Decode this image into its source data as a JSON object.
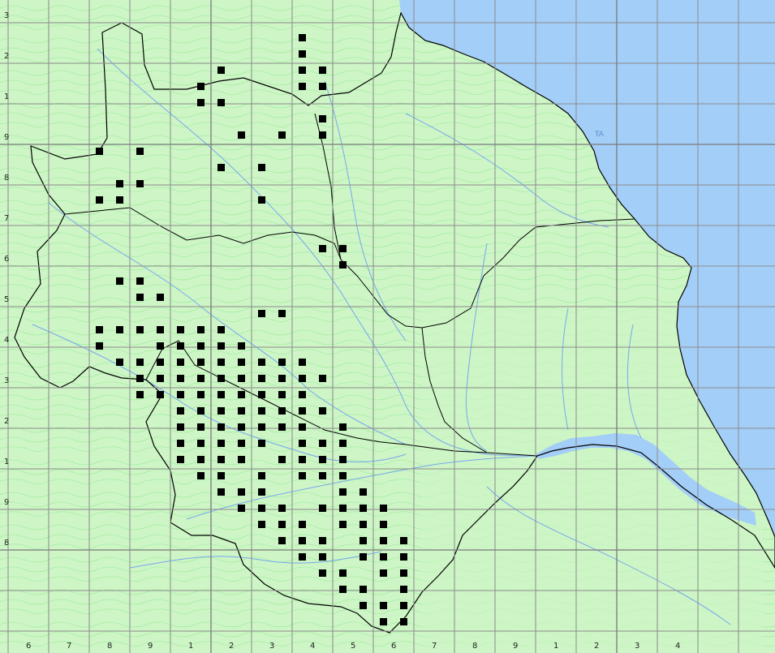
{
  "map": {
    "colors": {
      "land": "#cdf5c5",
      "sea": "#a3cef7",
      "contour": "#66e36f",
      "river": "#7aa7f0",
      "boundary": "#000000",
      "grid": "#8c8c8c",
      "record": "#000000"
    },
    "sea_label": "TA",
    "bottom_labels": [
      "6",
      "7",
      "8",
      "9",
      "1",
      "2",
      "3",
      "4",
      "5",
      "6",
      "7",
      "8",
      "9",
      "1",
      "2",
      "3",
      "4"
    ],
    "left_labels": [
      "3",
      "2",
      "1",
      "9",
      "8",
      "7",
      "6",
      "5",
      "4",
      "3",
      "2",
      "1",
      "9",
      "8"
    ],
    "records": [
      [
        14,
        1
      ],
      [
        14,
        2
      ],
      [
        14,
        3
      ],
      [
        15,
        3
      ],
      [
        10,
        3
      ],
      [
        9,
        4
      ],
      [
        14,
        4
      ],
      [
        15,
        4
      ],
      [
        9,
        5
      ],
      [
        10,
        5
      ],
      [
        15,
        6
      ],
      [
        11,
        7
      ],
      [
        13,
        7
      ],
      [
        15,
        7
      ],
      [
        4,
        8
      ],
      [
        6,
        8
      ],
      [
        10,
        9
      ],
      [
        12,
        9
      ],
      [
        5,
        10
      ],
      [
        6,
        10
      ],
      [
        4,
        11
      ],
      [
        5,
        11
      ],
      [
        12,
        11
      ],
      [
        15,
        14
      ],
      [
        16,
        14
      ],
      [
        16,
        15
      ],
      [
        5,
        16
      ],
      [
        6,
        16
      ],
      [
        6,
        17
      ],
      [
        7,
        17
      ],
      [
        12,
        18
      ],
      [
        13,
        18
      ],
      [
        4,
        19
      ],
      [
        5,
        19
      ],
      [
        6,
        19
      ],
      [
        7,
        19
      ],
      [
        8,
        19
      ],
      [
        9,
        19
      ],
      [
        10,
        19
      ],
      [
        4,
        20
      ],
      [
        7,
        20
      ],
      [
        8,
        20
      ],
      [
        9,
        20
      ],
      [
        10,
        20
      ],
      [
        11,
        20
      ],
      [
        5,
        21
      ],
      [
        6,
        21
      ],
      [
        7,
        21
      ],
      [
        8,
        21
      ],
      [
        9,
        21
      ],
      [
        10,
        21
      ],
      [
        11,
        21
      ],
      [
        12,
        21
      ],
      [
        13,
        21
      ],
      [
        14,
        21
      ],
      [
        6,
        22
      ],
      [
        7,
        22
      ],
      [
        8,
        22
      ],
      [
        9,
        22
      ],
      [
        10,
        22
      ],
      [
        11,
        22
      ],
      [
        12,
        22
      ],
      [
        13,
        22
      ],
      [
        14,
        22
      ],
      [
        15,
        22
      ],
      [
        6,
        23
      ],
      [
        7,
        23
      ],
      [
        8,
        23
      ],
      [
        9,
        23
      ],
      [
        10,
        23
      ],
      [
        11,
        23
      ],
      [
        12,
        23
      ],
      [
        13,
        23
      ],
      [
        14,
        23
      ],
      [
        8,
        24
      ],
      [
        9,
        24
      ],
      [
        10,
        24
      ],
      [
        11,
        24
      ],
      [
        12,
        24
      ],
      [
        13,
        24
      ],
      [
        14,
        24
      ],
      [
        15,
        24
      ],
      [
        8,
        25
      ],
      [
        9,
        25
      ],
      [
        10,
        25
      ],
      [
        11,
        25
      ],
      [
        12,
        25
      ],
      [
        13,
        25
      ],
      [
        14,
        25
      ],
      [
        16,
        25
      ],
      [
        8,
        26
      ],
      [
        9,
        26
      ],
      [
        10,
        26
      ],
      [
        11,
        26
      ],
      [
        12,
        26
      ],
      [
        14,
        26
      ],
      [
        15,
        26
      ],
      [
        16,
        26
      ],
      [
        8,
        27
      ],
      [
        9,
        27
      ],
      [
        10,
        27
      ],
      [
        11,
        27
      ],
      [
        13,
        27
      ],
      [
        14,
        27
      ],
      [
        15,
        27
      ],
      [
        16,
        27
      ],
      [
        9,
        28
      ],
      [
        10,
        28
      ],
      [
        12,
        28
      ],
      [
        14,
        28
      ],
      [
        15,
        28
      ],
      [
        16,
        28
      ],
      [
        10,
        29
      ],
      [
        11,
        29
      ],
      [
        12,
        29
      ],
      [
        16,
        29
      ],
      [
        17,
        29
      ],
      [
        11,
        30
      ],
      [
        12,
        30
      ],
      [
        13,
        30
      ],
      [
        15,
        30
      ],
      [
        16,
        30
      ],
      [
        17,
        30
      ],
      [
        18,
        30
      ],
      [
        12,
        31
      ],
      [
        13,
        31
      ],
      [
        14,
        31
      ],
      [
        16,
        31
      ],
      [
        17,
        31
      ],
      [
        18,
        31
      ],
      [
        13,
        32
      ],
      [
        14,
        32
      ],
      [
        15,
        32
      ],
      [
        17,
        32
      ],
      [
        18,
        32
      ],
      [
        19,
        32
      ],
      [
        14,
        33
      ],
      [
        15,
        33
      ],
      [
        17,
        33
      ],
      [
        18,
        33
      ],
      [
        19,
        33
      ],
      [
        15,
        34
      ],
      [
        16,
        34
      ],
      [
        18,
        34
      ],
      [
        19,
        34
      ],
      [
        16,
        35
      ],
      [
        17,
        35
      ],
      [
        19,
        35
      ],
      [
        17,
        36
      ],
      [
        18,
        36
      ],
      [
        19,
        36
      ],
      [
        18,
        37
      ],
      [
        19,
        37
      ]
    ]
  }
}
